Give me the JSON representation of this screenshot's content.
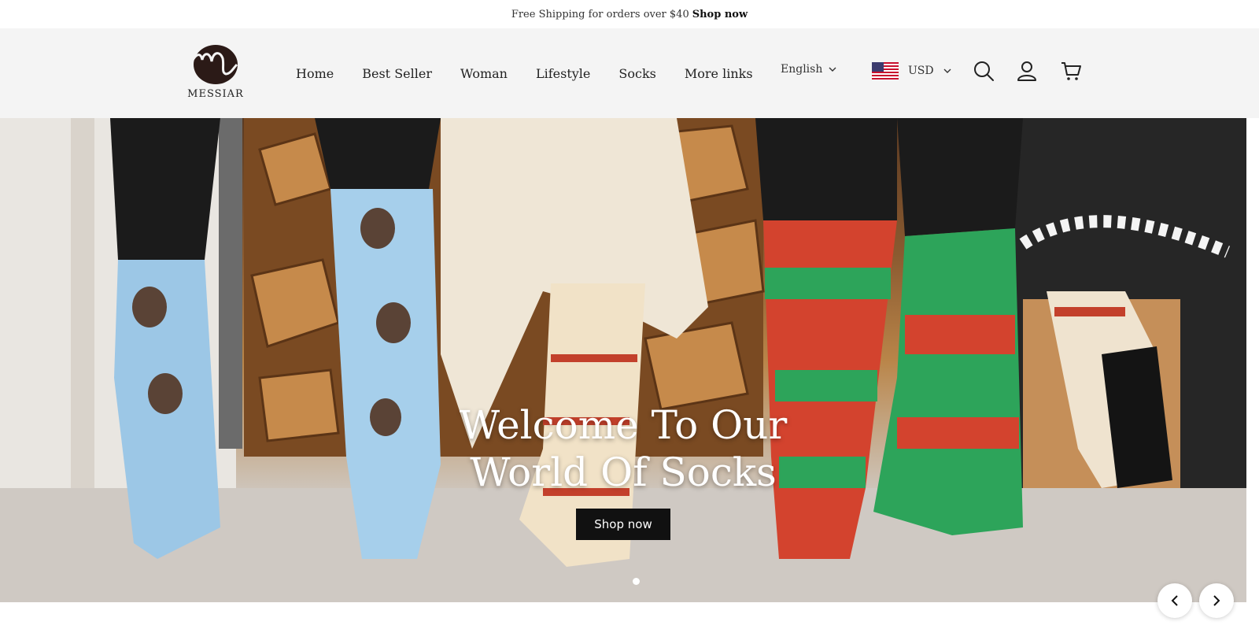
{
  "announcement": {
    "text": "Free Shipping for orders over $40",
    "link": "Shop now"
  },
  "logo": {
    "text": "MESSIAR"
  },
  "nav": {
    "items": [
      "Home",
      "Best Seller",
      "Woman",
      "Lifestyle",
      "Socks",
      "More links"
    ]
  },
  "language": {
    "selected": "English"
  },
  "currency": {
    "selected": "USD"
  },
  "icons": [
    "search-icon",
    "account-icon",
    "cart-icon",
    "chevron-down-icon",
    "us-flag-icon",
    "chevron-left-icon",
    "chevron-right-icon"
  ],
  "hero": {
    "title_line1": "Welcome To Our",
    "title_line2": "World Of Socks",
    "button": "Shop now",
    "slide_count": 1,
    "active_slide": 1
  },
  "colors": {
    "accent": "#111111",
    "header_bg": "#f4f4f4"
  }
}
